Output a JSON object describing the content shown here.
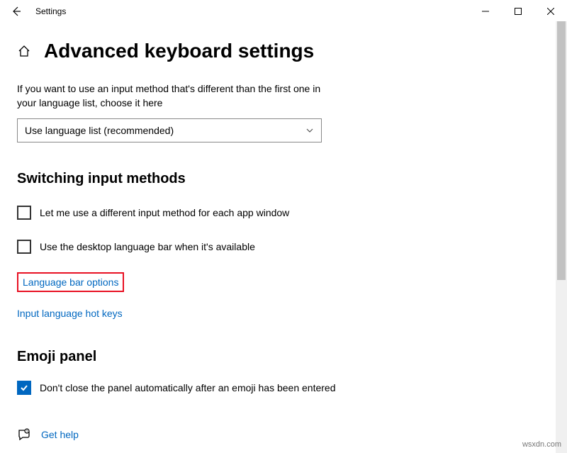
{
  "titlebar": {
    "title": "Settings"
  },
  "page": {
    "heading": "Advanced keyboard settings",
    "description": "If you want to use an input method that's different than the first one in your language list, choose it here",
    "dropdown_value": "Use language list (recommended)"
  },
  "switching": {
    "heading": "Switching input methods",
    "opt1": "Let me use a different input method for each app window",
    "opt2": "Use the desktop language bar when it's available",
    "link_langbar": "Language bar options",
    "link_hotkeys": "Input language hot keys"
  },
  "emoji": {
    "heading": "Emoji panel",
    "opt1": "Don't close the panel automatically after an emoji has been entered"
  },
  "help": {
    "label": "Get help"
  },
  "watermark": "wsxdn.com",
  "colors": {
    "link": "#0067c0",
    "highlight": "#e81123"
  }
}
